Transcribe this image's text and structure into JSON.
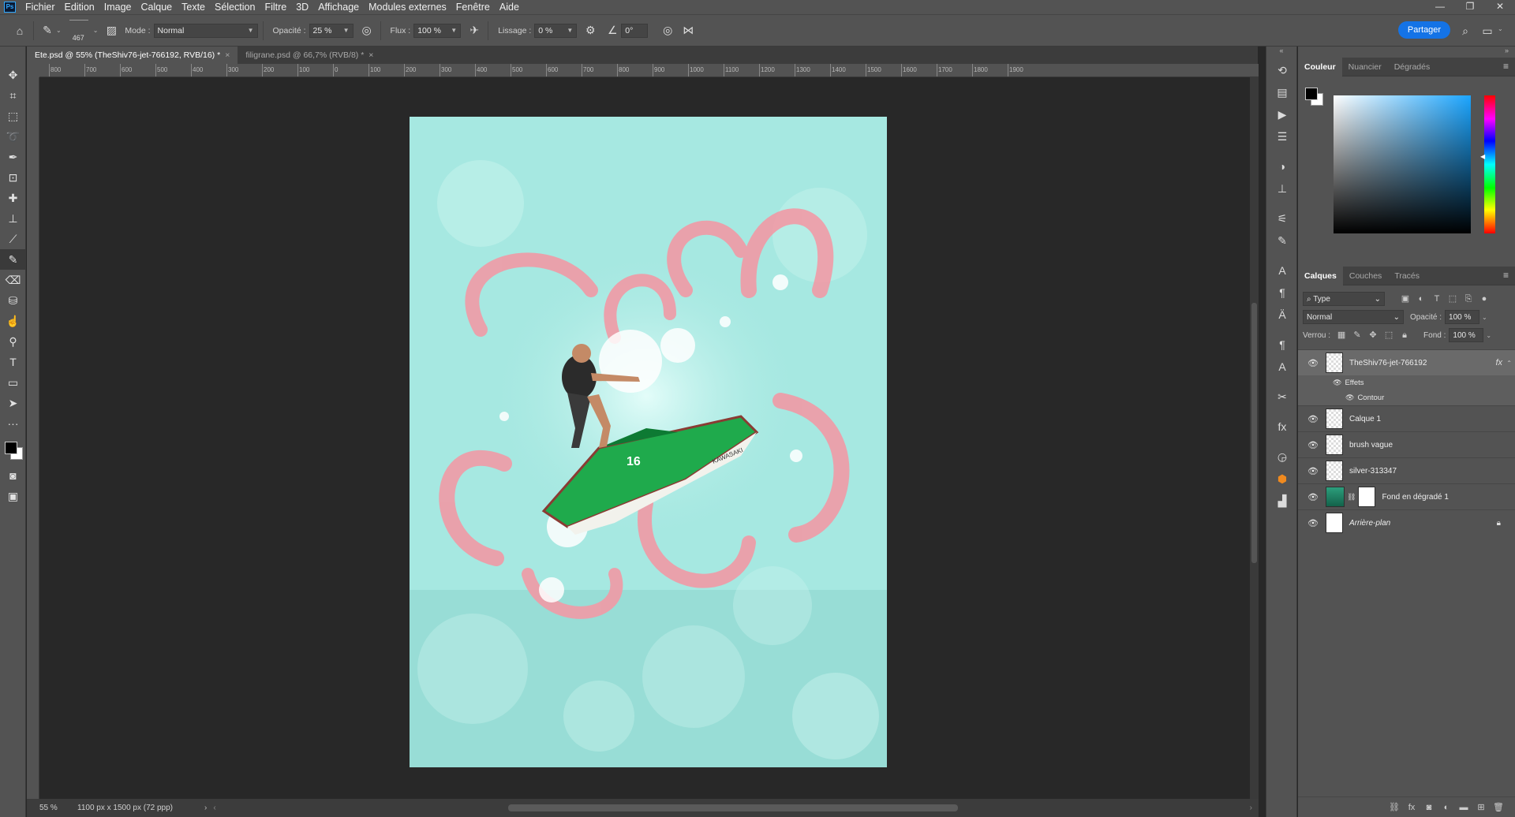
{
  "app": {
    "logo": "Ps"
  },
  "menu": [
    "Fichier",
    "Edition",
    "Image",
    "Calque",
    "Texte",
    "Sélection",
    "Filtre",
    "3D",
    "Affichage",
    "Modules externes",
    "Fenêtre",
    "Aide"
  ],
  "options": {
    "brush_size": "467",
    "mode_label": "Mode :",
    "mode_value": "Normal",
    "opacity_label": "Opacité :",
    "opacity_value": "25 %",
    "flow_label": "Flux :",
    "flow_value": "100 %",
    "smoothing_label": "Lissage :",
    "smoothing_value": "0 %",
    "angle_value": "0°",
    "share_label": "Partager"
  },
  "tabs": [
    {
      "label": "Ete.psd @ 55% (TheShiv76-jet-766192, RVB/16) *"
    },
    {
      "label": "filigrane.psd @ 66,7% (RVB/8) *"
    }
  ],
  "ruler_top": [
    "800",
    "700",
    "600",
    "500",
    "400",
    "300",
    "200",
    "100",
    "0",
    "100",
    "200",
    "300",
    "400",
    "500",
    "600",
    "700",
    "800",
    "900",
    "1000",
    "1100",
    "1200",
    "1300",
    "1400",
    "1500",
    "1600",
    "1700",
    "1800",
    "1900"
  ],
  "status": {
    "zoom": "55 %",
    "doc_info": "1100 px x 1500 px (72 ppp)"
  },
  "color_panel": {
    "tabs": [
      "Couleur",
      "Nuancier",
      "Dégradés"
    ],
    "foreground": "#000000",
    "background": "#ffffff"
  },
  "layers_panel": {
    "tabs": [
      "Calques",
      "Couches",
      "Tracés"
    ],
    "filter_value": "Type",
    "blend_value": "Normal",
    "opacity_label": "Opacité :",
    "opacity_value": "100 %",
    "lock_label": "Verrou :",
    "fill_label": "Fond :",
    "fill_value": "100 %",
    "layers": [
      {
        "name": "TheShiv76-jet-766192",
        "fx": "fx",
        "effects_label": "Effets",
        "effect": "Contour"
      },
      {
        "name": "Calque 1"
      },
      {
        "name": "brush vague"
      },
      {
        "name": "silver-313347"
      },
      {
        "name": "Fond en dégradé 1"
      },
      {
        "name": "Arrière-plan"
      }
    ]
  },
  "artwork": {
    "background_color": "#a6e8e1",
    "tentacle_color": "#f19aa6",
    "jetski_number": "16",
    "jetski_brand": "KAWASAKI",
    "jetski_body": "#1faa4c"
  }
}
